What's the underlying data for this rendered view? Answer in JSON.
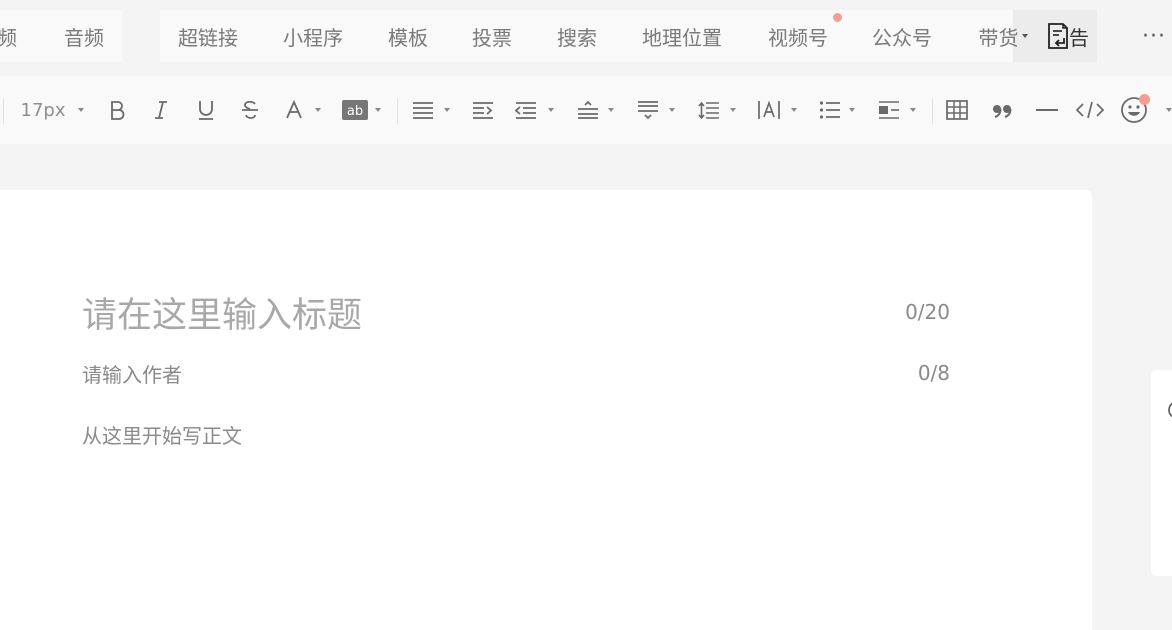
{
  "insert_tabs": {
    "items": [
      {
        "label": "频"
      },
      {
        "label": "音频"
      },
      {
        "label": "超链接"
      },
      {
        "label": "小程序"
      },
      {
        "label": "模板"
      },
      {
        "label": "投票"
      },
      {
        "label": "搜索"
      },
      {
        "label": "地理位置"
      },
      {
        "label": "视频号"
      },
      {
        "label": "公众号"
      },
      {
        "label": "带货"
      },
      {
        "label": "告"
      }
    ],
    "more_label": "···"
  },
  "toolbar": {
    "font_size": "17px",
    "accent_dot_color": "#f59d94"
  },
  "editor": {
    "title_placeholder": "请在这里输入标题",
    "title_count": "0/20",
    "author_placeholder": "请输入作者",
    "author_count": "0/8",
    "body_placeholder": "从这里开始写正文"
  }
}
